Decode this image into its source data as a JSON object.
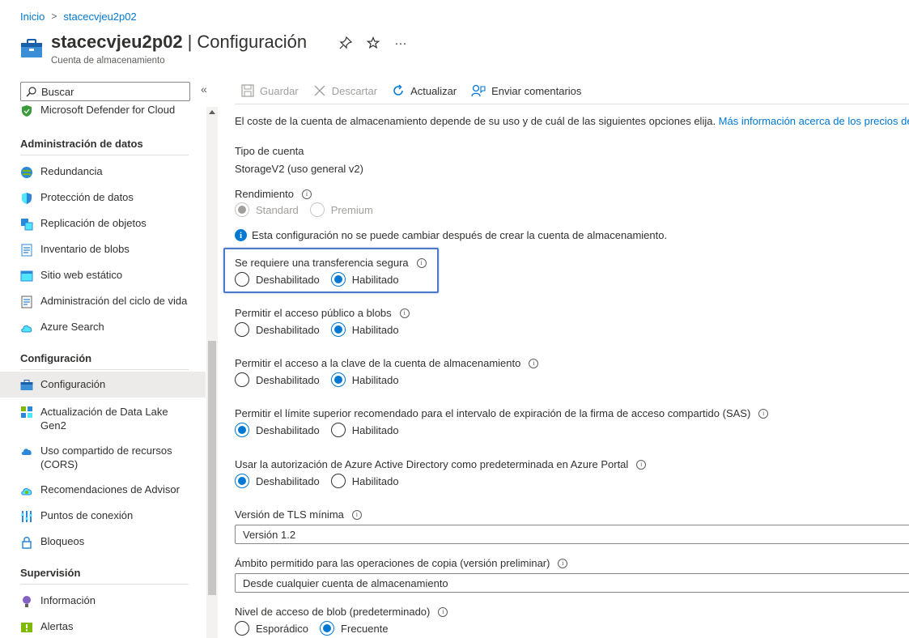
{
  "breadcrumb": {
    "home": "Inicio",
    "separator": ">",
    "current": "stacecvjeu2p02"
  },
  "header": {
    "resource_name": "stacecvjeu2p02",
    "divider": "|",
    "page": "Configuración",
    "subtitle": "Cuenta de almacenamiento",
    "more": "···"
  },
  "sidebar": {
    "search_placeholder": "Buscar",
    "collapse": "«",
    "top_item": "Microsoft Defender for Cloud",
    "sections": [
      {
        "title": "Administración de datos",
        "items": [
          {
            "label": "Redundancia",
            "icon": "globe-icon"
          },
          {
            "label": "Protección de datos",
            "icon": "shield-icon"
          },
          {
            "label": "Replicación de objetos",
            "icon": "replication-icon"
          },
          {
            "label": "Inventario de blobs",
            "icon": "inventory-icon"
          },
          {
            "label": "Sitio web estático",
            "icon": "website-icon"
          },
          {
            "label": "Administración del ciclo de vida",
            "icon": "lifecycle-icon"
          },
          {
            "label": "Azure Search",
            "icon": "cloud-search-icon"
          }
        ]
      },
      {
        "title": "Configuración",
        "items": [
          {
            "label": "Configuración",
            "icon": "storage-config-icon",
            "active": true
          },
          {
            "label": "Actualización de Data Lake Gen2",
            "icon": "datalake-icon"
          },
          {
            "label": "Uso compartido de recursos (CORS)",
            "icon": "cors-icon"
          },
          {
            "label": "Recomendaciones de Advisor",
            "icon": "advisor-icon"
          },
          {
            "label": "Puntos de conexión",
            "icon": "endpoints-icon"
          },
          {
            "label": "Bloqueos",
            "icon": "lock-icon"
          }
        ]
      },
      {
        "title": "Supervisión",
        "items": [
          {
            "label": "Información",
            "icon": "insights-icon"
          },
          {
            "label": "Alertas",
            "icon": "alerts-icon"
          }
        ]
      }
    ]
  },
  "toolbar": {
    "save": "Guardar",
    "discard": "Descartar",
    "refresh": "Actualizar",
    "feedback": "Enviar comentarios"
  },
  "content": {
    "description": "El coste de la cuenta de almacenamiento depende de su uso y de cuál de las siguientes opciones elija. ",
    "description_link": "Más información acerca de los precios de a",
    "account_type_label": "Tipo de cuenta",
    "account_type_value": "StorageV2 (uso general v2)",
    "performance_label": "Rendimiento",
    "performance_options": [
      "Standard",
      "Premium"
    ],
    "performance_selected": "Standard",
    "performance_note": "Esta configuración no se puede cambiar después de crear la cuenta de almacenamiento.",
    "settings": [
      {
        "label": "Se requiere una transferencia segura",
        "options": [
          "Deshabilitado",
          "Habilitado"
        ],
        "selected": 1
      },
      {
        "label": "Permitir el acceso público a blobs",
        "options": [
          "Deshabilitado",
          "Habilitado"
        ],
        "selected": 1
      },
      {
        "label": "Permitir el acceso a la clave de la cuenta de almacenamiento",
        "options": [
          "Deshabilitado",
          "Habilitado"
        ],
        "selected": 1
      },
      {
        "label": "Permitir el límite superior recomendado para el intervalo de expiración de la firma de acceso compartido (SAS)",
        "options": [
          "Deshabilitado",
          "Habilitado"
        ],
        "selected": 0
      },
      {
        "label": "Usar la autorización de Azure Active Directory como predeterminada en Azure Portal",
        "options": [
          "Deshabilitado",
          "Habilitado"
        ],
        "selected": 0
      }
    ],
    "tls_label": "Versión de TLS mínima",
    "tls_value": "Versión 1.2",
    "copy_scope_label": "Ámbito permitido para las operaciones de copia (versión preliminar)",
    "copy_scope_value": "Desde cualquier cuenta de almacenamiento",
    "blob_tier_label": "Nivel de acceso de blob (predeterminado)",
    "blob_tier_options": [
      "Esporádico",
      "Frecuente"
    ],
    "blob_tier_selected": 1
  }
}
